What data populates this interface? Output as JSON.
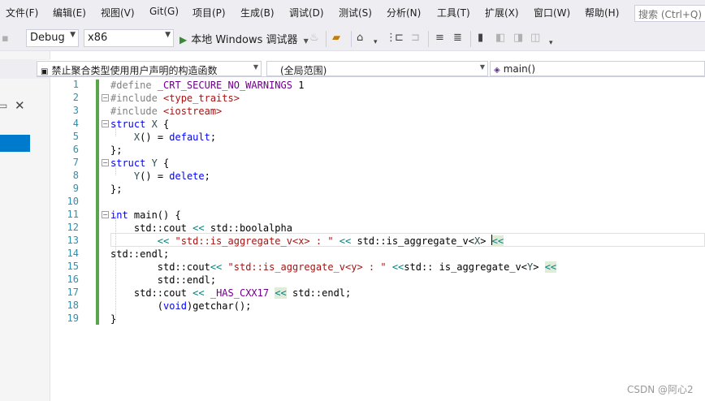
{
  "menu": {
    "items": [
      "文件(F)",
      "编辑(E)",
      "视图(V)",
      "Git(G)",
      "项目(P)",
      "生成(B)",
      "调试(D)",
      "测试(S)",
      "分析(N)",
      "工具(T)",
      "扩展(X)",
      "窗口(W)",
      "帮助(H)"
    ],
    "search_placeholder": "搜索 (Ctrl+Q)"
  },
  "toolbar": {
    "config": "Debug",
    "platform": "x86",
    "run_label": "本地 Windows 调试器"
  },
  "navbar": {
    "scope_project": "禁止聚合类型使用用户声明的构造函数",
    "scope_global": "(全局范围)",
    "scope_member": "main()"
  },
  "editor": {
    "line_numbers": [
      "1",
      "2",
      "3",
      "4",
      "5",
      "6",
      "7",
      "8",
      "9",
      "10",
      "11",
      "12",
      "13",
      "14",
      "15",
      "16",
      "17",
      "18",
      "19"
    ],
    "lines": [
      [
        {
          "t": "#define ",
          "c": "pp"
        },
        {
          "t": "_CRT_SECURE_NO_WARNINGS",
          "c": "mac"
        },
        {
          "t": " 1",
          "c": ""
        }
      ],
      [
        {
          "t": "#include ",
          "c": "pp"
        },
        {
          "t": "<type_traits>",
          "c": "str"
        }
      ],
      [
        {
          "t": "#include ",
          "c": "pp"
        },
        {
          "t": "<iostream>",
          "c": "str"
        }
      ],
      [
        {
          "t": "struct",
          "c": "kw"
        },
        {
          "t": " ",
          "c": ""
        },
        {
          "t": "X",
          "c": "id"
        },
        {
          "t": " {",
          "c": ""
        }
      ],
      [
        {
          "t": "    ",
          "c": ""
        },
        {
          "t": "X",
          "c": "id"
        },
        {
          "t": "() = ",
          "c": ""
        },
        {
          "t": "default",
          "c": "kw"
        },
        {
          "t": ";",
          "c": ""
        }
      ],
      [
        {
          "t": "};",
          "c": ""
        }
      ],
      [
        {
          "t": "struct",
          "c": "kw"
        },
        {
          "t": " ",
          "c": ""
        },
        {
          "t": "Y",
          "c": "id"
        },
        {
          "t": " {",
          "c": ""
        }
      ],
      [
        {
          "t": "    ",
          "c": ""
        },
        {
          "t": "Y",
          "c": "id"
        },
        {
          "t": "() = ",
          "c": ""
        },
        {
          "t": "delete",
          "c": "kw"
        },
        {
          "t": ";",
          "c": ""
        }
      ],
      [
        {
          "t": "};",
          "c": ""
        }
      ],
      [],
      [
        {
          "t": "int",
          "c": "kw"
        },
        {
          "t": " main() {",
          "c": ""
        }
      ],
      [
        {
          "t": "    std::cout ",
          "c": ""
        },
        {
          "t": "<<",
          "c": "op"
        },
        {
          "t": " std::boolalpha",
          "c": ""
        }
      ],
      [
        {
          "t": "        ",
          "c": ""
        },
        {
          "t": "<<",
          "c": "op"
        },
        {
          "t": " ",
          "c": ""
        },
        {
          "t": "\"std::is_aggregate_v<x> : \"",
          "c": "str"
        },
        {
          "t": " ",
          "c": ""
        },
        {
          "t": "<<",
          "c": "op"
        },
        {
          "t": " std::is_aggregate_v<",
          "c": ""
        },
        {
          "t": "X",
          "c": "id"
        },
        {
          "t": "> ",
          "c": ""
        },
        {
          "t": "<<",
          "c": "op hl"
        }
      ],
      [
        {
          "t": "std::endl;",
          "c": ""
        }
      ],
      [
        {
          "t": "        std::cout",
          "c": ""
        },
        {
          "t": "<<",
          "c": "op"
        },
        {
          "t": " ",
          "c": ""
        },
        {
          "t": "\"std::is_aggregate_v<y> : \"",
          "c": "str"
        },
        {
          "t": " ",
          "c": ""
        },
        {
          "t": "<<",
          "c": "op"
        },
        {
          "t": "std:: is_aggregate_v<",
          "c": ""
        },
        {
          "t": "Y",
          "c": "id"
        },
        {
          "t": "> ",
          "c": ""
        },
        {
          "t": "<<",
          "c": "op hl"
        }
      ],
      [
        {
          "t": "        std::endl;",
          "c": ""
        }
      ],
      [
        {
          "t": "    std::cout ",
          "c": ""
        },
        {
          "t": "<<",
          "c": "op"
        },
        {
          "t": " ",
          "c": ""
        },
        {
          "t": "_HAS_CXX17",
          "c": "mac"
        },
        {
          "t": " ",
          "c": ""
        },
        {
          "t": "<<",
          "c": "op hl"
        },
        {
          "t": " std::endl;",
          "c": ""
        }
      ],
      [
        {
          "t": "        (",
          "c": ""
        },
        {
          "t": "void",
          "c": "kw"
        },
        {
          "t": ")getchar();",
          "c": ""
        }
      ],
      [
        {
          "t": "}",
          "c": ""
        }
      ]
    ]
  },
  "watermark": "CSDN @阿心2"
}
